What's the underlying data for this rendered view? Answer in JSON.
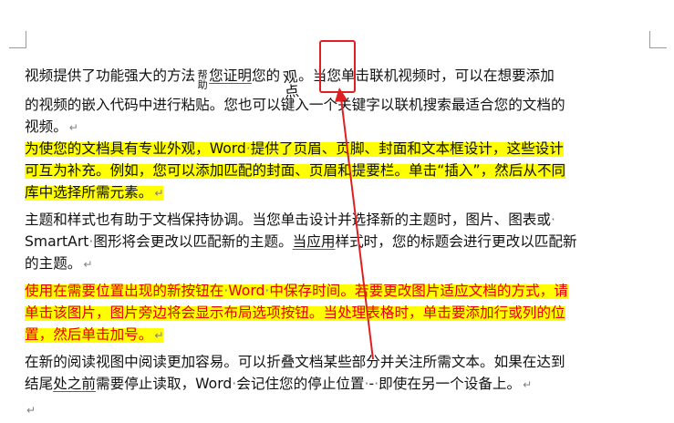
{
  "paragraphs": [
    {
      "id": "p1",
      "style": "normal",
      "lines": [
        [
          {
            "t": "视频提供了功能强大的方法"
          },
          {
            "t": "帮助",
            "vertical": true
          },
          {
            "t": "您证明",
            "underline": true
          },
          {
            "t": "您的"
          },
          {
            "t": "观点",
            "vertical": true,
            "big": true
          },
          {
            "t": "。当您单击联机视频时，可以在想要添加"
          }
        ],
        [
          {
            "t": "的视频的嵌入代码中进行粘贴。您也可以键入一个关键字以联机搜索最适合您的文档的"
          }
        ],
        [
          {
            "t": "视频。"
          },
          {
            "t": "↵",
            "mark": true
          }
        ]
      ]
    },
    {
      "id": "p2",
      "style": "highlight",
      "lines": [
        [
          {
            "t": "为使您的文档具有专业外观，Word"
          },
          {
            "t": "·",
            "dot": true
          },
          {
            "t": "提供了页眉、页脚、封面和文本框设计，这些设计"
          }
        ],
        [
          {
            "t": "可互为补充。例如，您可以添加匹配的封面、页眉和提要栏。单击“插入”，然后从不同"
          }
        ],
        [
          {
            "t": "库中选择所需元素。"
          },
          {
            "t": "↵",
            "mark": true
          }
        ]
      ]
    },
    {
      "id": "p3",
      "style": "normal",
      "lines": [
        [
          {
            "t": "主题和样式也有助于文档保持协调。当您单击设计并选择新的主题时，图片、图表或"
          },
          {
            "t": "·",
            "dot": true
          }
        ],
        [
          {
            "t": "SmartArt"
          },
          {
            "t": "·",
            "dot": true
          },
          {
            "t": "图形将会更改以匹配新的主题。"
          },
          {
            "t": "当应用",
            "underline": true
          },
          {
            "t": "样式时，您的标题会进行更改以匹配新"
          }
        ],
        [
          {
            "t": "的主题。"
          },
          {
            "t": "↵",
            "mark": true
          }
        ]
      ]
    },
    {
      "id": "p4",
      "style": "highlight-red",
      "lines": [
        [
          {
            "t": "使用在需要位置出现的新按钮在"
          },
          {
            "t": "·",
            "dot": true
          },
          {
            "t": "Word"
          },
          {
            "t": "·",
            "dot": true
          },
          {
            "t": "中保存时间。若要更改图片适应文档的方式，请"
          }
        ],
        [
          {
            "t": "单击该图片，图片旁边将会显示布局选项按钮。当处理表格时，单击要添加行或列的位"
          }
        ],
        [
          {
            "t": "置，然后单击加号。"
          },
          {
            "t": "↵",
            "mark": true
          }
        ]
      ]
    },
    {
      "id": "p5",
      "style": "normal",
      "lines": [
        [
          {
            "t": "在新的阅读视图中阅读更加容易。可以折叠文档某些部分并关注所需文本。如果在达到"
          }
        ],
        [
          {
            "t": "结尾"
          },
          {
            "t": "处之前",
            "underline": true
          },
          {
            "t": "需要停止读取，Word"
          },
          {
            "t": "·",
            "dot": true
          },
          {
            "t": "会记住您的停止位置"
          },
          {
            "t": "·",
            "dot": true
          },
          {
            "t": "-"
          },
          {
            "t": "·",
            "dot": true
          },
          {
            "t": "即使在另一个设备上。"
          },
          {
            "t": "↵",
            "mark": true
          }
        ]
      ]
    },
    {
      "id": "p6",
      "style": "normal",
      "lines": [
        [
          {
            "t": "↵",
            "mark": true
          }
        ]
      ]
    }
  ],
  "colors": {
    "highlight": "#ffff00",
    "red_text": "#e60000",
    "annotation": "#e02020",
    "underline": "#3b5fb8"
  }
}
